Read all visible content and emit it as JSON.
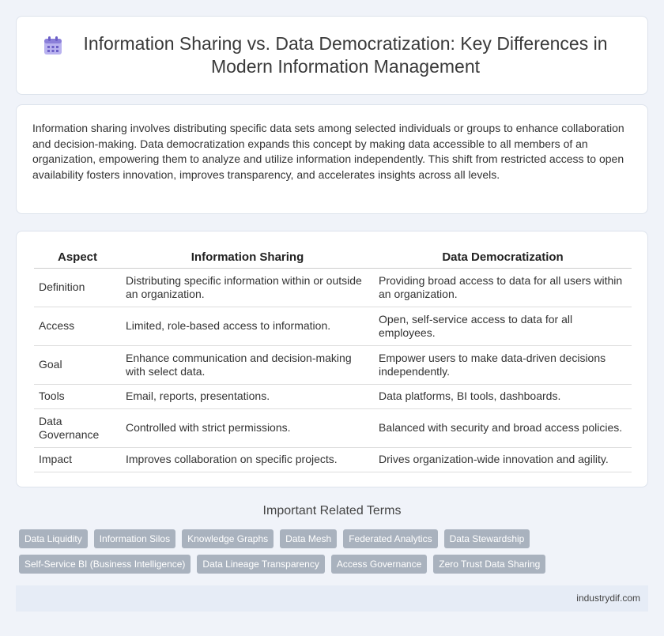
{
  "header": {
    "icon": "calendar-grid-icon",
    "title": "Information Sharing vs. Data Democratization: Key Differences in Modern Information Management"
  },
  "intro": "Information sharing involves distributing specific data sets among selected individuals or groups to enhance collaboration and decision-making. Data democratization expands this concept by making data accessible to all members of an organization, empowering them to analyze and utilize information independently. This shift from restricted access to open availability fosters innovation, improves transparency, and accelerates insights across all levels.",
  "table": {
    "headers": [
      "Aspect",
      "Information Sharing",
      "Data Democratization"
    ],
    "rows": [
      [
        "Definition",
        "Distributing specific information within or outside an organization.",
        "Providing broad access to data for all users within an organization."
      ],
      [
        "Access",
        "Limited, role-based access to information.",
        "Open, self-service access to data for all employees."
      ],
      [
        "Goal",
        "Enhance communication and decision-making with select data.",
        "Empower users to make data-driven decisions independently."
      ],
      [
        "Tools",
        "Email, reports, presentations.",
        "Data platforms, BI tools, dashboards."
      ],
      [
        "Data Governance",
        "Controlled with strict permissions.",
        "Balanced with security and broad access policies."
      ],
      [
        "Impact",
        "Improves collaboration on specific projects.",
        "Drives organization-wide innovation and agility."
      ]
    ]
  },
  "related": {
    "title": "Important Related Terms",
    "rows": [
      [
        "Data Liquidity",
        "Information Silos",
        "Knowledge Graphs",
        "Data Mesh",
        "Federated Analytics",
        "Data Stewardship"
      ],
      [
        "Self-Service BI (Business Intelligence)",
        "Data Lineage Transparency",
        "Access Governance",
        "Zero Trust Data Sharing"
      ]
    ]
  },
  "footer": {
    "site": "industrydif.com"
  },
  "colors": {
    "background": "#f0f3f9",
    "tag": "#a9b2be",
    "footer": "#e6ecf6",
    "icon": "#8b7fd9"
  }
}
